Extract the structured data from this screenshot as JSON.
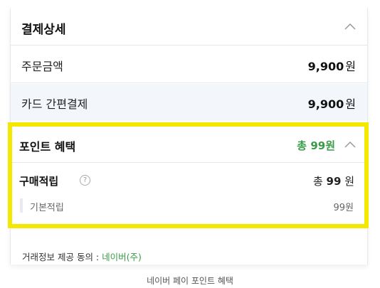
{
  "payment_detail": {
    "title": "결제상세",
    "order_amount": {
      "label": "주문금액",
      "value": "9,900",
      "unit": "원"
    },
    "card_payment": {
      "label": "카드 간편결제",
      "value": "9,900",
      "unit": "원"
    }
  },
  "points": {
    "title": "포인트 혜택",
    "total": "총 99원",
    "purchase": {
      "label": "구매적립",
      "prefix": "총",
      "value": "99",
      "unit": "원",
      "help_icon": "?"
    },
    "basic": {
      "label": "기본적립",
      "value": "99원"
    }
  },
  "consent": {
    "label": "거래정보 제공 동의 : ",
    "company": "네이버(주)"
  },
  "caption": "네이버 페이 포인트 혜택",
  "colors": {
    "highlight": "#f5e800",
    "accent_green": "#3a9a48",
    "card_row_bg": "#f3f7fb"
  },
  "icons": {
    "collapse": "chevron-up-icon",
    "help": "question-circle-icon"
  }
}
